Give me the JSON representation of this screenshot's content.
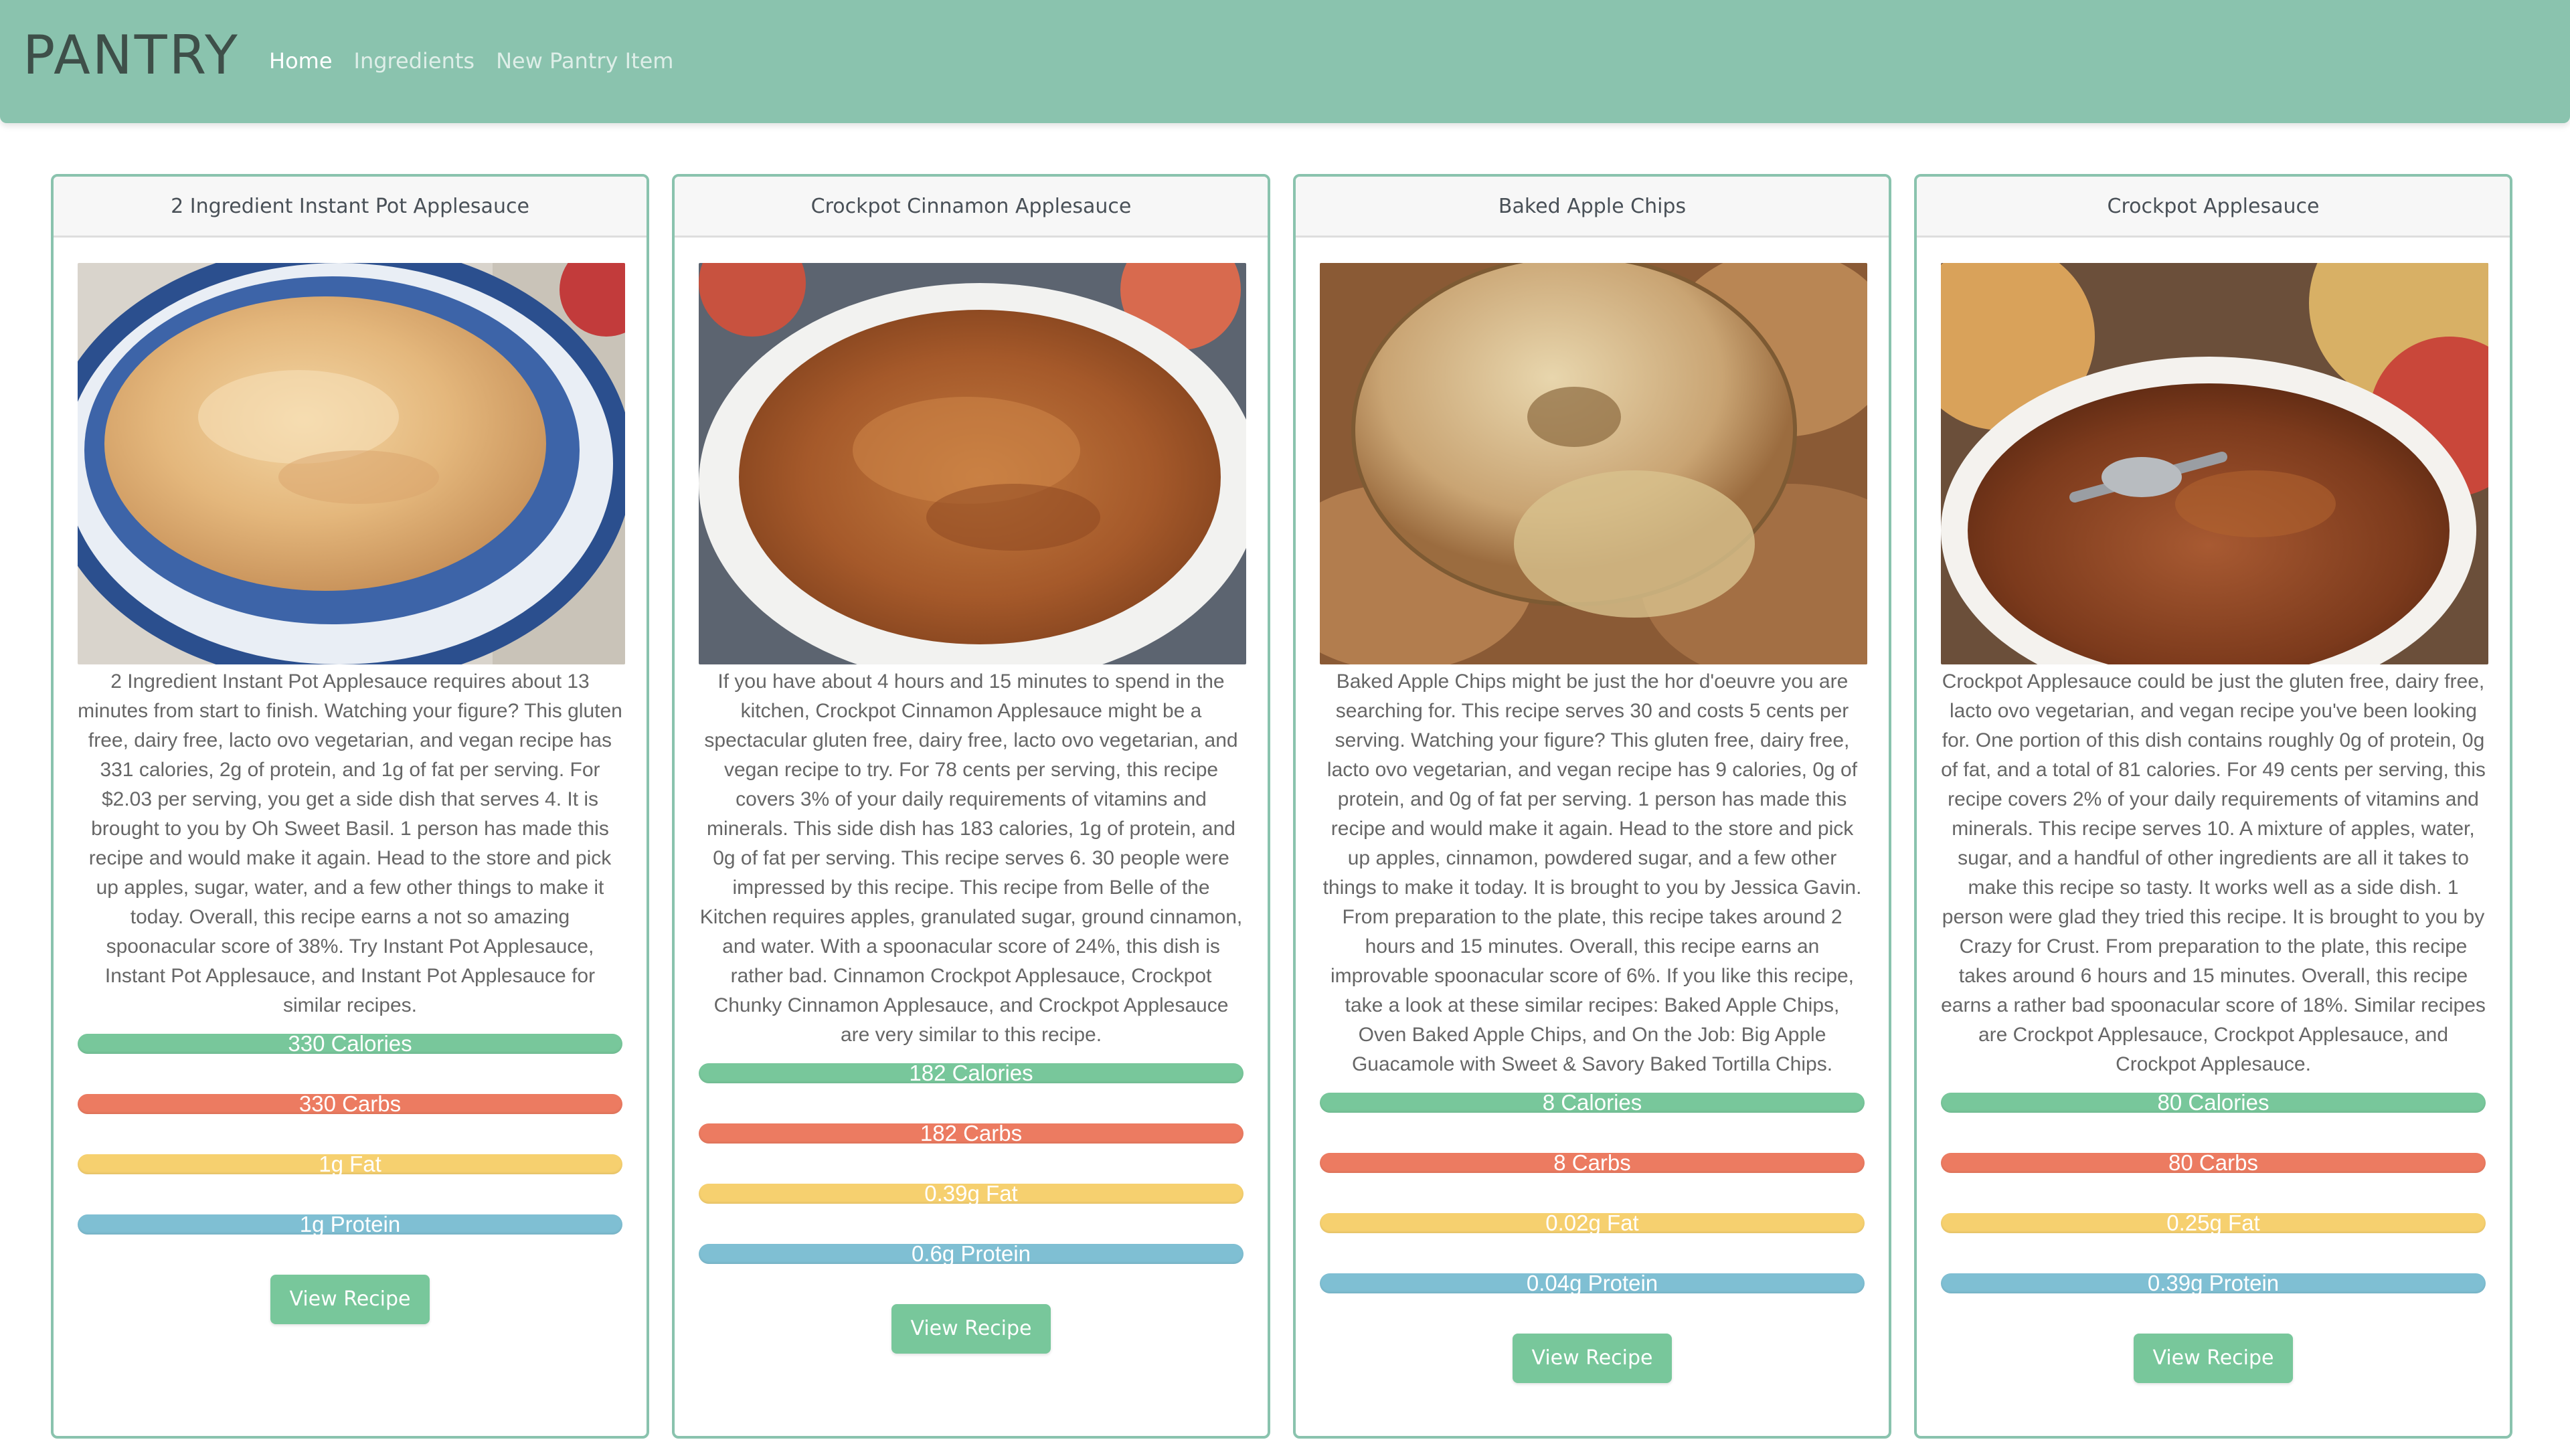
{
  "navbar": {
    "brand": "PANTRY",
    "links": [
      {
        "label": "Home",
        "active": true
      },
      {
        "label": "Ingredients",
        "active": false
      },
      {
        "label": "New Pantry Item",
        "active": false
      }
    ]
  },
  "colors": {
    "navbar": "#8ac3ae",
    "calories": "#78c79b",
    "carbs": "#ec7b61",
    "fat": "#f6d06f",
    "protein": "#7fbfd3",
    "button": "#78c79b"
  },
  "cards": [
    {
      "title": "2 Ingredient Instant Pot Applesauce",
      "image": "applesauce-blue-bowl-photo",
      "description": "2 Ingredient Instant Pot Applesauce requires about 13 minutes from start to finish. Watching your figure? This gluten free, dairy free, lacto ovo vegetarian, and vegan recipe has 331 calories, 2g of protein, and 1g of fat per serving. For $2.03 per serving, you get a side dish that serves 4. It is brought to you by Oh Sweet Basil. 1 person has made this recipe and would make it again. Head to the store and pick up apples, sugar, water, and a few other things to make it today. Overall, this recipe earns a not so amazing spoonacular score of 38%. Try Instant Pot Applesauce, Instant Pot Applesauce, and Instant Pot Applesauce for similar recipes.",
      "calories": "330 Calories",
      "carbs": "330 Carbs",
      "fat": "1g Fat",
      "protein": "1g Protein",
      "button": "View Recipe"
    },
    {
      "title": "Crockpot Cinnamon Applesauce",
      "image": "cinnamon-applesauce-white-bowl-photo",
      "description": "If you have about 4 hours and 15 minutes to spend in the kitchen, Crockpot Cinnamon Applesauce might be a spectacular gluten free, dairy free, lacto ovo vegetarian, and vegan recipe to try. For 78 cents per serving, this recipe covers 3% of your daily requirements of vitamins and minerals. This side dish has 183 calories, 1g of protein, and 0g of fat per serving. This recipe serves 6. 30 people were impressed by this recipe. This recipe from Belle of the Kitchen requires apples, granulated sugar, ground cinnamon, and water. With a spoonacular score of 24%, this dish is rather bad. Cinnamon Crockpot Applesauce, Crockpot Chunky Cinnamon Applesauce, and Crockpot Applesauce are very similar to this recipe.",
      "calories": "182 Calories",
      "carbs": "182 Carbs",
      "fat": "0.39g Fat",
      "protein": "0.6g Protein",
      "button": "View Recipe"
    },
    {
      "title": "Baked Apple Chips",
      "image": "baked-apple-chips-photo",
      "description": "Baked Apple Chips might be just the hor d'oeuvre you are searching for. This recipe serves 30 and costs 5 cents per serving. Watching your figure? This gluten free, dairy free, lacto ovo vegetarian, and vegan recipe has 9 calories, 0g of protein, and 0g of fat per serving. 1 person has made this recipe and would make it again. Head to the store and pick up apples, cinnamon, powdered sugar, and a few other things to make it today. It is brought to you by Jessica Gavin. From preparation to the plate, this recipe takes around 2 hours and 15 minutes. Overall, this recipe earns an improvable spoonacular score of 6%. If you like this recipe, take a look at these similar recipes: Baked Apple Chips, Oven Baked Apple Chips, and On the Job: Big Apple Guacamole with Sweet & Savory Baked Tortilla Chips.",
      "calories": "8 Calories",
      "carbs": "8 Carbs",
      "fat": "0.02g Fat",
      "protein": "0.04g Protein",
      "button": "View Recipe"
    },
    {
      "title": "Crockpot Applesauce",
      "image": "crockpot-applesauce-spoon-photo",
      "description": "Crockpot Applesauce could be just the gluten free, dairy free, lacto ovo vegetarian, and vegan recipe you've been looking for. One portion of this dish contains roughly 0g of protein, 0g of fat, and a total of 81 calories. For 49 cents per serving, this recipe covers 2% of your daily requirements of vitamins and minerals. This recipe serves 10. A mixture of apples, water, sugar, and a handful of other ingredients are all it takes to make this recipe so tasty. It works well as a side dish. 1 person were glad they tried this recipe. It is brought to you by Crazy for Crust. From preparation to the plate, this recipe takes around 6 hours and 15 minutes. Overall, this recipe earns a rather bad spoonacular score of 18%. Similar recipes are Crockpot Applesauce, Crockpot Applesauce, and Crockpot Applesauce.",
      "calories": "80 Calories",
      "carbs": "80 Carbs",
      "fat": "0.25g Fat",
      "protein": "0.39g Protein",
      "button": "View Recipe"
    }
  ]
}
